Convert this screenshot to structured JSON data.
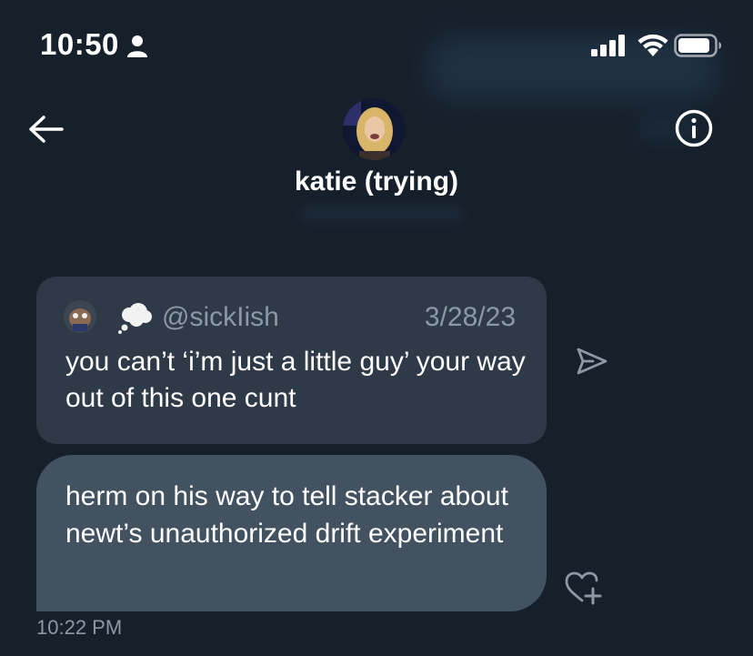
{
  "status_bar": {
    "time": "10:50",
    "person_icon": "person-icon",
    "signal_icon": "cellular-signal-icon",
    "wifi_icon": "wifi-icon",
    "battery_icon": "battery-icon"
  },
  "header": {
    "back_icon": "arrow-left-icon",
    "info_icon": "info-icon",
    "conversation_name": "katie (trying)"
  },
  "messages": [
    {
      "type": "quoted_tweet",
      "handle": "@sickIish",
      "date": "3/28/23",
      "text": "you can’t ‘i’m just a little guy’ your way out of this one cunt",
      "share_icon": "send-icon"
    },
    {
      "type": "message",
      "text": "herm on his way to tell stacker about newt’s unauthorized drift experiment",
      "react_icon": "heart-plus-icon",
      "timestamp": "10:22 PM"
    }
  ],
  "colors": {
    "background": "#15202b",
    "quote_bubble": "#2e3a47",
    "message_bubble": "#435261",
    "muted_text": "#8b98a5"
  }
}
